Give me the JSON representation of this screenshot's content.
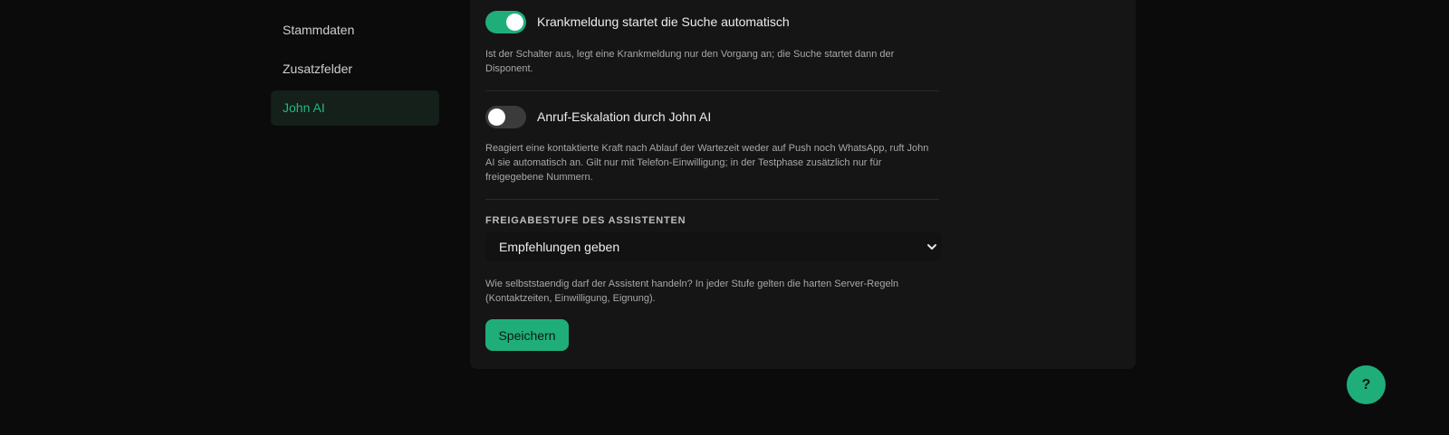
{
  "sidebar": {
    "items": [
      {
        "label": "Stammdaten"
      },
      {
        "label": "Zusatzfelder"
      },
      {
        "label": "John AI"
      }
    ]
  },
  "settings": {
    "auto_search": {
      "label": "Krankmeldung startet die Suche automatisch",
      "enabled": true,
      "description": "Ist der Schalter aus, legt eine Krankmeldung nur den Vorgang an; die Suche startet dann der Disponent."
    },
    "call_escalation": {
      "label": "Anruf-Eskalation durch John AI",
      "enabled": false,
      "description": "Reagiert eine kontaktierte Kraft nach Ablauf der Wartezeit weder auf Push noch WhatsApp, ruft John AI sie automatisch an. Gilt nur mit Telefon-Einwilligung; in der Testphase zusätzlich nur für freigegebene Nummern."
    },
    "approval_level": {
      "section_label": "FREIGABESTUFE DES ASSISTENTEN",
      "selected": "Empfehlungen geben",
      "description": "Wie selbststaendig darf der Assistent handeln? In jeder Stufe gelten die harten Server-Regeln (Kontaktzeiten, Einwilligung, Eignung)."
    }
  },
  "actions": {
    "save_label": "Speichern",
    "help_label": "?"
  },
  "colors": {
    "accent": "#1fae7a",
    "active_text": "#22b783",
    "background": "#0b0b0b",
    "card": "#151515"
  },
  "icons": {
    "dropdown": "chevron-down-icon",
    "help": "help-icon"
  }
}
